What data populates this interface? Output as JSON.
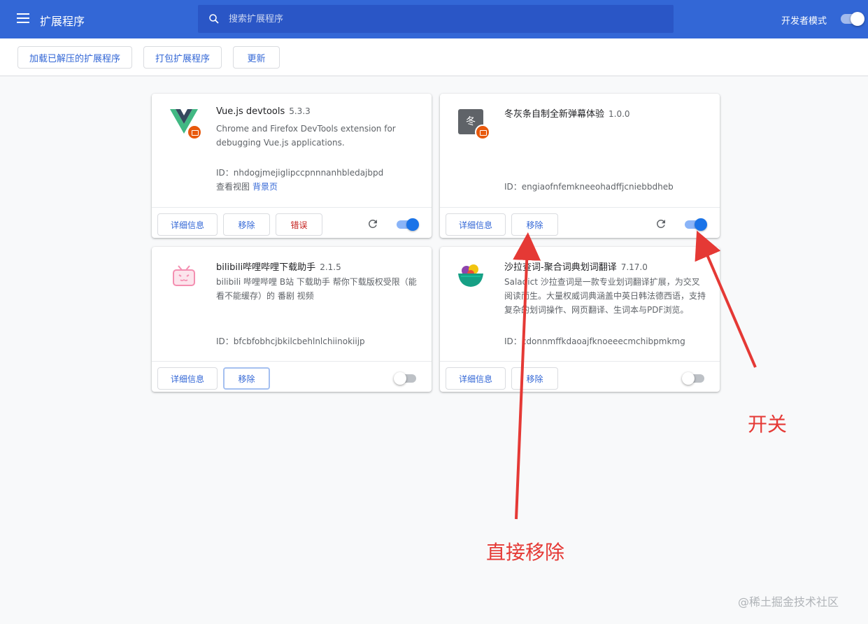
{
  "header": {
    "title": "扩展程序",
    "search_placeholder": "搜索扩展程序",
    "dev_mode_label": "开发者模式"
  },
  "toolbar": {
    "load_unpacked": "加载已解压的扩展程序",
    "pack": "打包扩展程序",
    "update": "更新"
  },
  "extensions": [
    {
      "name": "Vue.js devtools",
      "version": "5.3.3",
      "description": "Chrome and Firefox DevTools extension for debugging Vue.js applications.",
      "id": "ID：nhdogjmejiglipccpnnnanhbledajbpd",
      "views_label": "查看视图",
      "views_link": "背景页",
      "details": "详细信息",
      "remove": "移除",
      "errors": "错误",
      "enabled": true
    },
    {
      "name": "冬灰条自制全新弹幕体验",
      "version": "1.0.0",
      "icon_text": "冬",
      "id": "ID：engiaofnfemkneeohadffjcniebbdheb",
      "details": "详细信息",
      "remove": "移除",
      "enabled": true
    },
    {
      "name": "bilibili哔哩哔哩下载助手",
      "version": "2.1.5",
      "description": "bilibili 哔哩哔哩 B站 下载助手 帮你下载版权受限（能看不能缓存）的 番剧 视频",
      "id": "ID：bfcbfobhcjbkilcbehlnlchiinokiijp",
      "details": "详细信息",
      "remove": "移除",
      "enabled": false
    },
    {
      "name": "沙拉查词-聚合词典划词翻译",
      "version": "7.17.0",
      "description": "Saladict 沙拉查词是一款专业划词翻译扩展，为交叉阅读而生。大量权威词典涵盖中英日韩法德西语，支持复杂的划词操作、网页翻译、生词本与PDF浏览。",
      "id": "ID：cdonnmffkdaoajfknoeeecmchibpmkmg",
      "details": "详细信息",
      "remove": "移除",
      "enabled": false
    }
  ],
  "annotations": {
    "switch": "开关",
    "remove_direct": "直接移除",
    "color": "#e53935"
  },
  "watermark": "@稀土掘金技术社区",
  "colors": {
    "topbar": "#3367d6",
    "accent": "#1a73e8"
  }
}
